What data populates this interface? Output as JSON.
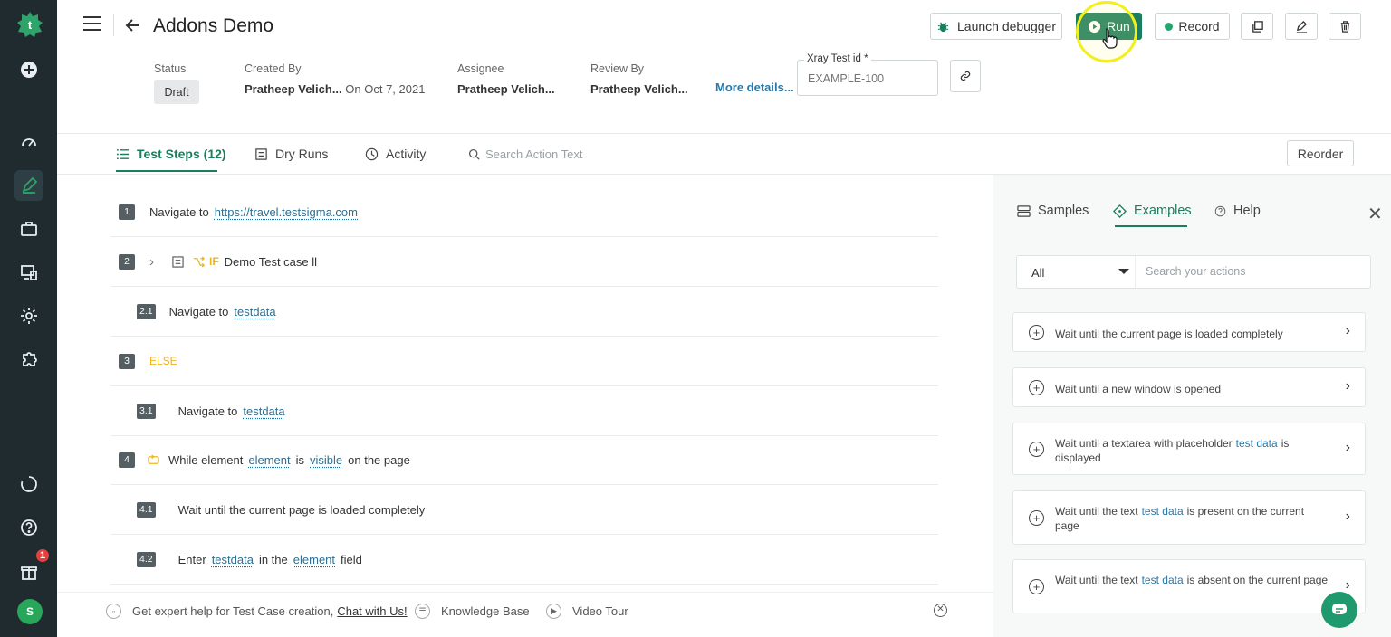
{
  "header": {
    "title": "Addons Demo",
    "buttons": {
      "debugger": "Launch debugger",
      "run": "Run",
      "record": "Record"
    }
  },
  "meta": {
    "status_label": "Status",
    "status_value": "Draft",
    "created_by_label": "Created By",
    "created_by_value": "Pratheep Velich...",
    "created_on": "On Oct 7, 2021",
    "assignee_label": "Assignee",
    "assignee_value": "Pratheep Velich...",
    "review_label": "Review By",
    "review_value": "Pratheep Velich...",
    "more_details": "More details...",
    "xray_label": "Xray Test id *",
    "xray_placeholder": "EXAMPLE-100"
  },
  "tabs": {
    "steps": "Test Steps (12)",
    "dry_runs": "Dry Runs",
    "activity": "Activity",
    "search_placeholder": "Search Action Text",
    "reorder": "Reorder"
  },
  "steps": [
    {
      "num": "1",
      "pre": "Navigate to",
      "link": "https://travel.testsigma.com"
    },
    {
      "num": "2",
      "kw": "IF",
      "text": "Demo Test case ll"
    },
    {
      "num": "2.1",
      "pre": "Navigate to",
      "link": "testdata"
    },
    {
      "num": "3",
      "kw": "ELSE"
    },
    {
      "num": "3.1",
      "pre": "Navigate to",
      "link": "testdata"
    },
    {
      "num": "4",
      "pre": "While element",
      "el": "element",
      "mid": "is",
      "cond": "visible",
      "post": "on the page"
    },
    {
      "num": "4.1",
      "text": "Wait until the current page is loaded completely"
    },
    {
      "num": "4.2",
      "pre": "Enter",
      "td": "testdata",
      "mid": "in the",
      "el": "element",
      "post": "field"
    }
  ],
  "right_panel": {
    "tabs": {
      "samples": "Samples",
      "examples": "Examples",
      "help": "Help"
    },
    "filter_value": "All",
    "search_placeholder": "Search your actions",
    "cards": [
      {
        "text": "Wait until the current page is loaded completely"
      },
      {
        "text": "Wait until a new window is opened"
      },
      {
        "pre": "Wait until a textarea with placeholder",
        "hl": "test data",
        "post": "is displayed"
      },
      {
        "pre": "Wait until the text",
        "hl": "test data",
        "post": "is present on the current page"
      },
      {
        "pre": "Wait until the text",
        "hl": "test data",
        "post": "is absent on the current page"
      }
    ]
  },
  "footer": {
    "help_text": "Get expert help for Test Case creation,",
    "chat_link": "Chat with Us!",
    "kb": "Knowledge Base",
    "video": "Video Tour"
  },
  "nav": {
    "notification_count": "1",
    "avatar_initial": "S"
  },
  "colors": {
    "brand": "#1e7d5e",
    "rail": "#1f2b2f",
    "keyword": "#f0b321",
    "link": "#2a77a9"
  }
}
